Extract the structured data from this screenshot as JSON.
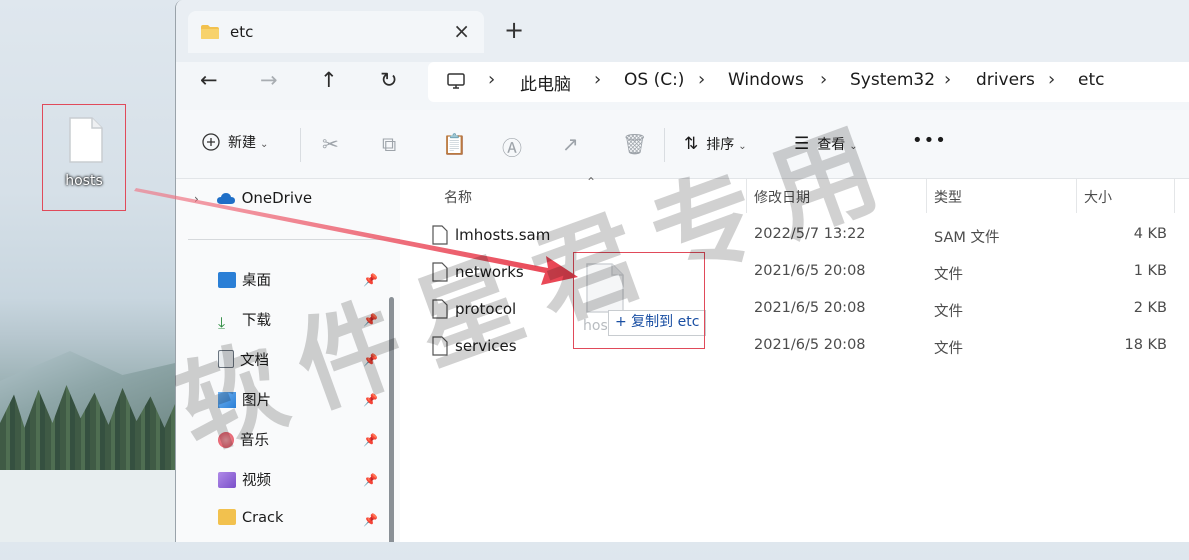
{
  "desktop": {
    "icon_label": "hosts"
  },
  "window": {
    "tab_title": "etc",
    "tab_close": "×",
    "new_tab": "+",
    "nav": {
      "back": "←",
      "forward": "→",
      "up": "↑",
      "refresh": "↻"
    },
    "breadcrumb": [
      "此电脑",
      "OS (C:)",
      "Windows",
      "System32",
      "drivers",
      "etc"
    ],
    "breadcrumb_separator": "›"
  },
  "toolbar": {
    "new_label": "新建",
    "sort_label": "排序",
    "view_label": "查看",
    "more": "•••"
  },
  "sidebar": {
    "onedrive": "OneDrive",
    "items": [
      {
        "label": "桌面",
        "icon": "desktop-icon",
        "color": "#2b7fd6"
      },
      {
        "label": "下载",
        "icon": "download-icon",
        "color": "#2b8a3e"
      },
      {
        "label": "文档",
        "icon": "document-icon",
        "color": "#6b7580"
      },
      {
        "label": "图片",
        "icon": "picture-icon",
        "color": "#2b7fd6"
      },
      {
        "label": "音乐",
        "icon": "music-icon",
        "color": "#e04a5a"
      },
      {
        "label": "视频",
        "icon": "video-icon",
        "color": "#7a4fc9"
      },
      {
        "label": "Crack",
        "icon": "folder-icon",
        "color": "#f2c14e"
      }
    ]
  },
  "columns": {
    "name": "名称",
    "modified": "修改日期",
    "type": "类型",
    "size": "大小"
  },
  "files": [
    {
      "name": "lmhosts.sam",
      "modified": "2022/5/7 13:22",
      "type": "SAM 文件",
      "size": "4 KB"
    },
    {
      "name": "networks",
      "modified": "2021/6/5 20:08",
      "type": "文件",
      "size": "1 KB"
    },
    {
      "name": "protocol",
      "modified": "2021/6/5 20:08",
      "type": "文件",
      "size": "2 KB"
    },
    {
      "name": "services",
      "modified": "2021/6/5 20:08",
      "type": "文件",
      "size": "18 KB"
    }
  ],
  "drag": {
    "tooltip": "+ 复制到 etc",
    "ghost_label": "hosts"
  },
  "watermark": "软件星君专用",
  "colors": {
    "highlight": "#e04a5a",
    "accent": "#1a4fa3"
  }
}
